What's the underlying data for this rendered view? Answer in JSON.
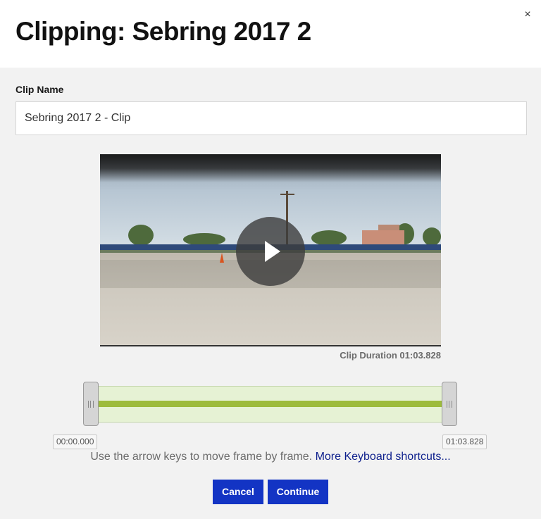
{
  "dialog": {
    "title": "Clipping: Sebring 2017 2",
    "close_icon": "×"
  },
  "form": {
    "clip_name_label": "Clip Name",
    "clip_name_value": "Sebring 2017 2 - Clip"
  },
  "video": {
    "play_icon": "play-icon",
    "duration_text": "Clip Duration 01:03.828"
  },
  "timeline": {
    "start_time": "00:00.000",
    "end_time": "01:03.828",
    "selection_start_fraction": 0,
    "selection_end_fraction": 1
  },
  "hint": {
    "text": "Use the arrow keys to move frame by frame.",
    "link": "More Keyboard shortcuts..."
  },
  "actions": {
    "cancel": "Cancel",
    "continue": "Continue"
  },
  "colors": {
    "primary_button": "#1334c4",
    "range_fill": "#e6f2d4",
    "range_line": "#9dbb3c",
    "link": "#0d1f8c"
  }
}
